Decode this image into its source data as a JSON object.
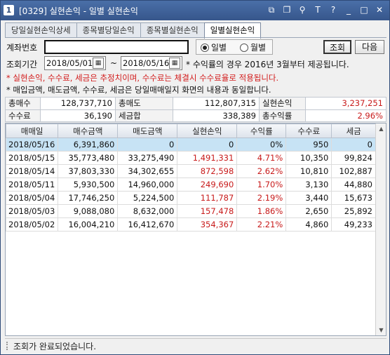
{
  "window": {
    "app_number": "1",
    "title": "[0329] 실현손익 - 일별 실현손익",
    "title_icons": [
      "window-restore-icon",
      "window-copy-icon",
      "link-icon",
      "text-icon",
      "help-icon",
      "minimize-icon",
      "maximize-icon",
      "close-icon"
    ],
    "title_glyphs": [
      "⧉",
      "❐",
      "⚲",
      "T",
      "?",
      "_",
      "□",
      "✕"
    ]
  },
  "tabs": [
    {
      "label": "당일실현손익상세"
    },
    {
      "label": "종목별당일손익"
    },
    {
      "label": "종목별실현손익"
    },
    {
      "label": "일별실현손익",
      "active": true
    }
  ],
  "form": {
    "account_label": "계좌번호",
    "account_value": "",
    "radio_daily": "일별",
    "radio_monthly": "월별",
    "period_label": "조회기간",
    "date_from": "2018/05/01",
    "date_to": "2018/05/16",
    "tilde": "~",
    "period_note": "* 수익률의 경우 2016년 3월부터 제공됩니다.",
    "search_button": "조회",
    "next_button": "다음",
    "note_red": "* 실현손익, 수수료, 세금은 추정치이며, 수수료는 체결시 수수료율로 적용됩니다.",
    "note_black": "* 매입금액, 매도금액, 수수료, 세금은 당일매매일지 화면의 내용과 동일합니다."
  },
  "summary": {
    "total_buy_label": "총매수",
    "total_buy": "128,737,710",
    "total_sell_label": "총매도",
    "total_sell": "112,807,315",
    "realized_label": "실현손익",
    "realized": "3,237,251",
    "fee_label": "수수료",
    "fee": "36,190",
    "tax_label": "세금합",
    "tax": "338,389",
    "return_label": "총수익률",
    "return": "2.96%"
  },
  "grid": {
    "headers": [
      "매매일",
      "매수금액",
      "매도금액",
      "실현손익",
      "수익률",
      "수수료",
      "세금"
    ],
    "rows": [
      [
        "2018/05/16",
        "6,391,860",
        "0",
        "0",
        "0%",
        "950",
        "0"
      ],
      [
        "2018/05/15",
        "35,773,480",
        "33,275,490",
        "1,491,331",
        "4.71%",
        "10,350",
        "99,824"
      ],
      [
        "2018/05/14",
        "37,803,330",
        "34,302,655",
        "872,598",
        "2.62%",
        "10,810",
        "102,887"
      ],
      [
        "2018/05/11",
        "5,930,500",
        "14,960,000",
        "249,690",
        "1.70%",
        "3,130",
        "44,880"
      ],
      [
        "2018/05/04",
        "17,746,250",
        "5,224,500",
        "111,787",
        "2.19%",
        "3,440",
        "15,673"
      ],
      [
        "2018/05/03",
        "9,088,080",
        "8,632,000",
        "157,478",
        "1.86%",
        "2,650",
        "25,892"
      ],
      [
        "2018/05/02",
        "16,004,210",
        "16,412,670",
        "354,367",
        "2.21%",
        "4,860",
        "49,233"
      ]
    ]
  },
  "status": {
    "message": "조회가 완료되었습니다."
  },
  "colors": {
    "accent": "#36568b",
    "profit": "#c81a1a",
    "selected_row": "#c7e3f5"
  }
}
